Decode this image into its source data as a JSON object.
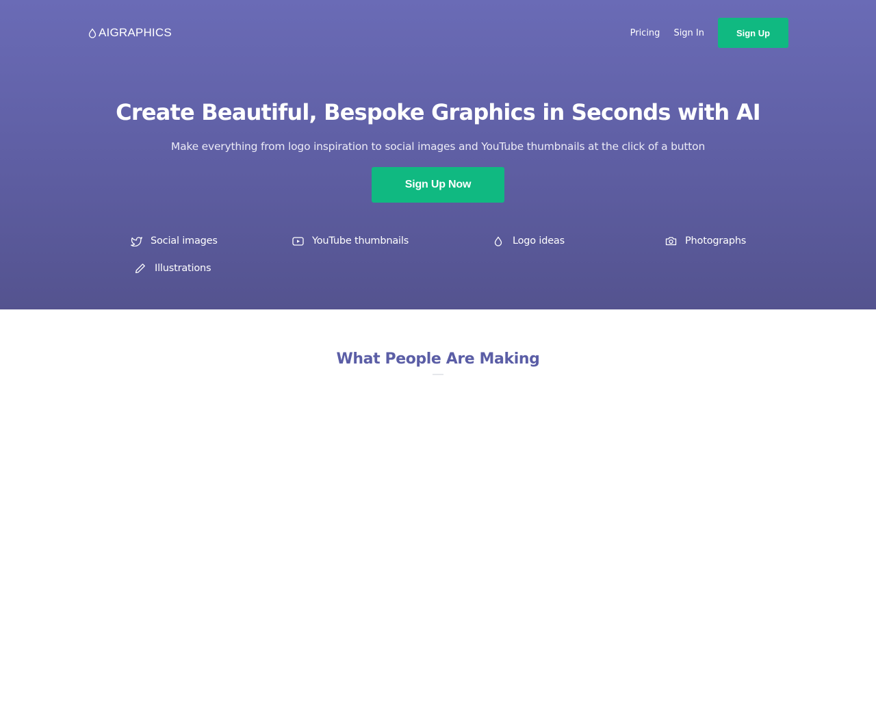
{
  "brand": {
    "name": "AIGRAPHICS",
    "logo_icon": "droplet-icon"
  },
  "nav": {
    "pricing": "Pricing",
    "sign_in": "Sign In",
    "sign_up": "Sign Up"
  },
  "hero": {
    "title": "Create Beautiful, Bespoke Graphics in Seconds with AI",
    "subtitle": "Make everything from logo inspiration to social images and YouTube thumbnails at the click of a button",
    "cta": "Sign Up Now"
  },
  "features": [
    {
      "label": "Social images",
      "icon": "twitter-bird-icon"
    },
    {
      "label": "YouTube thumbnails",
      "icon": "youtube-play-icon"
    },
    {
      "label": "Logo ideas",
      "icon": "droplet-icon"
    },
    {
      "label": "Photographs",
      "icon": "camera-icon"
    },
    {
      "label": "Illustrations",
      "icon": "pencil-icon"
    }
  ],
  "gallery": {
    "title": "What People Are Making"
  },
  "colors": {
    "hero_gradient_top": "#6a6bb6",
    "hero_gradient_bottom": "#54538f",
    "accent_green": "#10b981",
    "section_title": "#5b5ea6"
  }
}
